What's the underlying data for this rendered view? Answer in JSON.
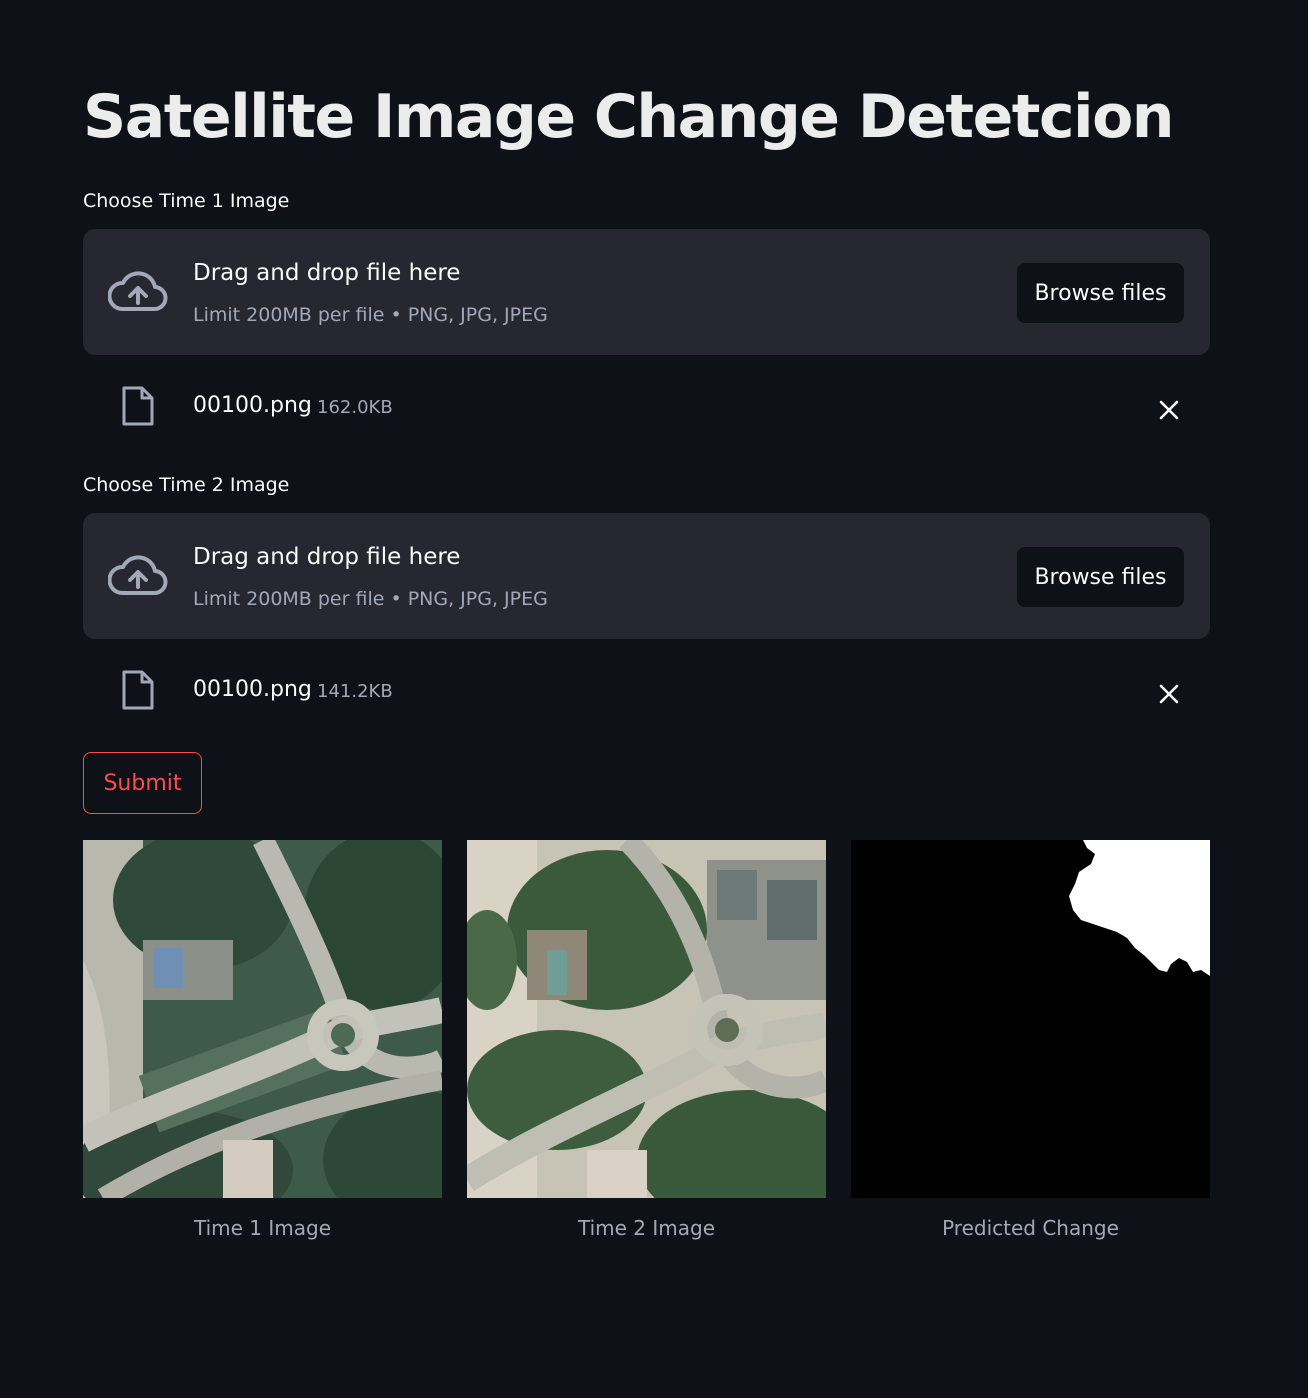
{
  "page": {
    "title": "Satellite Image Change Detetcion"
  },
  "uploaders": [
    {
      "label": "Choose Time 1 Image",
      "drop_text": "Drag and drop file here",
      "limit_text": "Limit 200MB per file • PNG, JPG, JPEG",
      "browse_label": "Browse files",
      "file": {
        "name": "00100.png",
        "size": "162.0KB"
      }
    },
    {
      "label": "Choose Time 2 Image",
      "drop_text": "Drag and drop file here",
      "limit_text": "Limit 200MB per file • PNG, JPG, JPEG",
      "browse_label": "Browse files",
      "file": {
        "name": "00100.png",
        "size": "141.2KB"
      }
    }
  ],
  "submit_label": "Submit",
  "results": [
    {
      "caption": "Time 1 Image"
    },
    {
      "caption": "Time 2 Image"
    },
    {
      "caption": "Predicted Change"
    }
  ],
  "colors": {
    "background": "#0e1117",
    "panel": "#262730",
    "accent": "#ff4b4b",
    "muted_text": "#a3a8b8"
  },
  "icons": [
    "cloud-upload-icon",
    "file-icon",
    "close-icon"
  ]
}
